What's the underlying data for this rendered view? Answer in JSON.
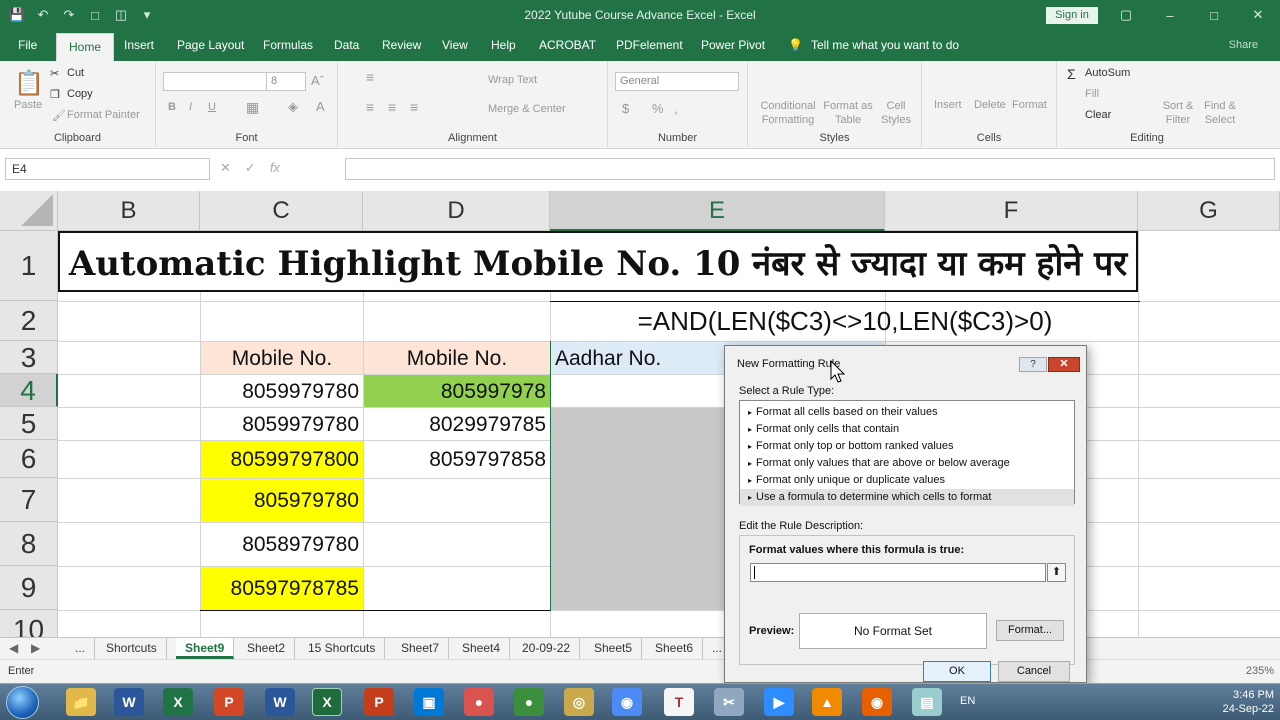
{
  "window": {
    "title": "2022 Yutube Course Advance Excel  -  Excel",
    "signin": "Sign in",
    "share": "Share"
  },
  "ribbon_tabs": [
    "File",
    "Home",
    "Insert",
    "Page Layout",
    "Formulas",
    "Data",
    "Review",
    "View",
    "Help",
    "ACROBAT",
    "PDFelement",
    "Power Pivot",
    "Tell me what you want to do"
  ],
  "ribbon": {
    "clipboard": {
      "paste": "Paste",
      "cut": "Cut",
      "copy": "Copy",
      "format_painter": "Format Painter",
      "label": "Clipboard"
    },
    "font": {
      "size": "8",
      "label": "Font"
    },
    "alignment": {
      "wrap": "Wrap Text",
      "merge": "Merge & Center",
      "label": "Alignment"
    },
    "number": {
      "format": "General",
      "label": "Number"
    },
    "styles": {
      "conditional": "Conditional Formatting",
      "format_table": "Format as Table",
      "cell_styles": "Cell Styles",
      "label": "Styles"
    },
    "cells": {
      "insert": "Insert",
      "delete": "Delete",
      "format": "Format",
      "label": "Cells"
    },
    "editing": {
      "autosum": "AutoSum",
      "fill": "Fill",
      "clear": "Clear",
      "sort": "Sort & Filter",
      "find": "Find & Select",
      "label": "Editing"
    }
  },
  "formula_bar": {
    "name_box": "E4",
    "value": ""
  },
  "columns": [
    "B",
    "C",
    "D",
    "E",
    "F",
    "G"
  ],
  "rows": [
    "1",
    "2",
    "3",
    "4",
    "5",
    "6",
    "7",
    "8",
    "9",
    "10"
  ],
  "sheet": {
    "title": "Automatic Highlight Mobile No. 10 नंबर से ज्यादा या कम होने पर",
    "formula_text": "=AND(LEN($C3)<>10,LEN($C3)>0)",
    "headers": {
      "c": "Mobile No.",
      "d": "Mobile No.",
      "e": "Aadhar No."
    },
    "col_c": [
      "8059979780",
      "8059979780",
      "80599797800",
      "805979780",
      "8058979780",
      "80597978785"
    ],
    "col_d": [
      "805997978",
      "8029979785",
      "8059797858"
    ]
  },
  "sheet_tabs": [
    "...",
    "Shortcuts",
    "Sheet9",
    "Sheet2",
    "15 Shortcuts",
    "Sheet7",
    "Sheet4",
    "20-09-22",
    "Sheet5",
    "Sheet6",
    "..."
  ],
  "status": {
    "mode": "Enter",
    "zoom": "235%"
  },
  "dialog": {
    "title": "New Formatting Rule",
    "help": "?",
    "close": "✕",
    "select_label": "Select a Rule Type:",
    "rule_types": [
      "Format all cells based on their values",
      "Format only cells that contain",
      "Format only top or bottom ranked values",
      "Format only values that are above or below average",
      "Format only unique or duplicate values",
      "Use a formula to determine which cells to format"
    ],
    "edit_label": "Edit the Rule Description:",
    "formula_label": "Format values where this formula is true:",
    "formula_value": "",
    "preview_label": "Preview:",
    "preview_text": "No Format Set",
    "format_button": "Format...",
    "ok": "OK",
    "cancel": "Cancel"
  },
  "taskbar": {
    "lang": "EN",
    "time": "3:46 PM",
    "date": "24-Sep-22"
  },
  "colors": {
    "excel_green": "#217346",
    "cell_yellow": "#ffff00",
    "cell_green": "#92d050",
    "header_peach": "#fce4d6",
    "header_blue": "#ddebf7",
    "cell_gray": "#c8c8c8"
  }
}
